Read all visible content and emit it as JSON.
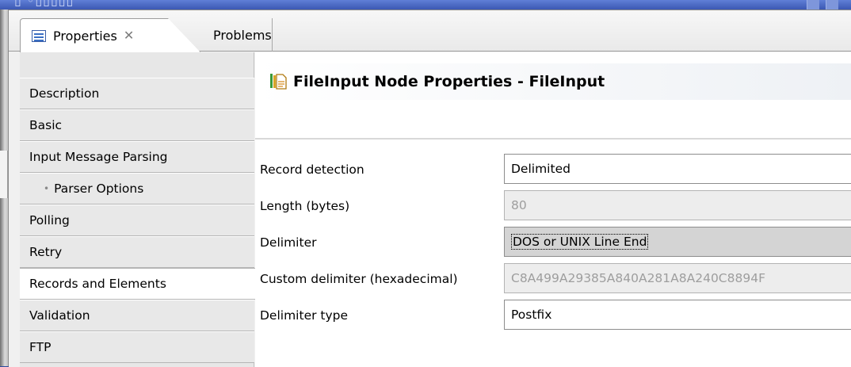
{
  "window": {
    "ghost_title": "▯ ◦▯▯▯▯▯"
  },
  "tabs": {
    "properties_label": "Properties",
    "close_glyph": "✕",
    "problems_label": "Problems"
  },
  "sidebar": {
    "items": [
      {
        "label": "Description"
      },
      {
        "label": "Basic"
      },
      {
        "label": "Input Message Parsing"
      },
      {
        "label": "Parser Options"
      },
      {
        "label": "Polling"
      },
      {
        "label": "Retry"
      },
      {
        "label": "Records and Elements"
      },
      {
        "label": "Validation"
      },
      {
        "label": "FTP"
      }
    ],
    "active_item": "Records and Elements"
  },
  "main": {
    "title": "FileInput Node Properties - FileInput",
    "rows": [
      {
        "label": "Record detection",
        "value": "Delimited",
        "enabled": true
      },
      {
        "label": "Length (bytes)",
        "value": "80",
        "enabled": false
      },
      {
        "label": "Delimiter",
        "value": "DOS or UNIX Line End",
        "enabled": true,
        "selected": true
      },
      {
        "label": "Custom delimiter (hexadecimal)",
        "value": "C8A499A29385A840A281A8A240C8894F",
        "enabled": false
      },
      {
        "label": "Delimiter type",
        "value": "Postfix",
        "enabled": true
      }
    ]
  },
  "colors": {
    "window_accent": "#3d5cb8",
    "panel_background": "#f0f0f0",
    "disabled_text": "#9e9e9e"
  }
}
